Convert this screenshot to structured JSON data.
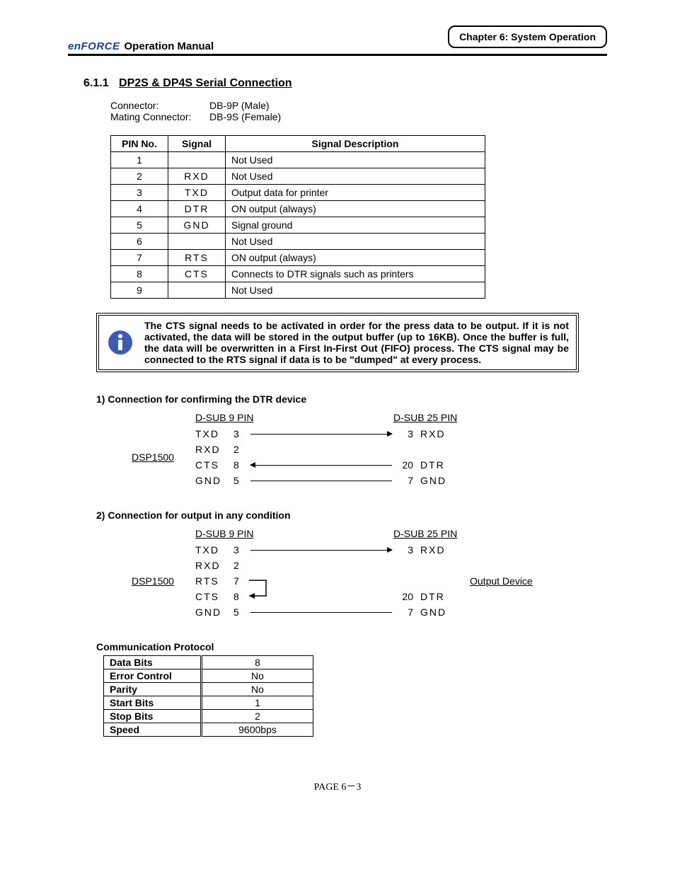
{
  "header": {
    "brand": "enFORCE",
    "manual_title": "Operation Manual",
    "chapter_box": "Chapter 6: System Operation"
  },
  "section": {
    "number": "6.1.1",
    "title": "DP2S & DP4S Serial Connection"
  },
  "connector": {
    "label1": "Connector:",
    "value1": "DB-9P (Male)",
    "label2": "Mating Connector:",
    "value2": "DB-9S (Female)"
  },
  "pin_table": {
    "headers": [
      "PIN No.",
      "Signal",
      "Signal Description"
    ],
    "rows": [
      {
        "pin": "1",
        "signal": "",
        "desc": "Not Used"
      },
      {
        "pin": "2",
        "signal": "RXD",
        "desc": "Not Used"
      },
      {
        "pin": "3",
        "signal": "TXD",
        "desc": "Output data for printer"
      },
      {
        "pin": "4",
        "signal": "DTR",
        "desc": "ON output (always)"
      },
      {
        "pin": "5",
        "signal": "GND",
        "desc": "Signal ground"
      },
      {
        "pin": "6",
        "signal": "",
        "desc": "Not Used"
      },
      {
        "pin": "7",
        "signal": "RTS",
        "desc": "ON output (always)"
      },
      {
        "pin": "8",
        "signal": "CTS",
        "desc": "Connects to DTR signals such as printers"
      },
      {
        "pin": "9",
        "signal": "",
        "desc": "Not Used"
      }
    ]
  },
  "note": "The CTS signal needs to be activated in order for the press data to be output. If it is not activated, the data will be stored in the output buffer (up to 16KB). Once the buffer is full, the data will be overwritten in a First In-First Out (FIFO) process. The CTS signal may be connected to the RTS signal if data is to be \"dumped\" at every process.",
  "diagram1": {
    "heading": "1) Connection for confirming the DTR device",
    "device": "DSP1500",
    "left_header": "D-SUB 9 PIN",
    "right_header": "D-SUB 25 PIN",
    "rows": [
      {
        "sigL": "TXD",
        "pinL": "3",
        "pinR": "3",
        "sigR": "RXD",
        "arrow": "r"
      },
      {
        "sigL": "RXD",
        "pinL": "2",
        "pinR": "",
        "sigR": "",
        "arrow": "none"
      },
      {
        "sigL": "CTS",
        "pinL": "8",
        "pinR": "20",
        "sigR": "DTR",
        "arrow": "l"
      },
      {
        "sigL": "GND",
        "pinL": "5",
        "pinR": "7",
        "sigR": "GND",
        "arrow": ""
      }
    ]
  },
  "diagram2": {
    "heading": "2) Connection for output in any condition",
    "device": "DSP1500",
    "left_header": "D-SUB 9 PIN",
    "right_header": "D-SUB 25 PIN",
    "output_device": "Output Device",
    "rows": [
      {
        "sigL": "TXD",
        "pinL": "3",
        "pinR": "3",
        "sigR": "RXD",
        "arrow": "r"
      },
      {
        "sigL": "RXD",
        "pinL": "2",
        "pinR": "",
        "sigR": "",
        "arrow": "none"
      },
      {
        "sigL": "RTS",
        "pinL": "7",
        "pinR": "",
        "sigR": "",
        "arrow": "loop_top"
      },
      {
        "sigL": "CTS",
        "pinL": "8",
        "pinR": "20",
        "sigR": "DTR",
        "arrow": "loop_bot"
      },
      {
        "sigL": "GND",
        "pinL": "5",
        "pinR": "7",
        "sigR": "GND",
        "arrow": ""
      }
    ]
  },
  "protocol": {
    "heading": "Communication Protocol",
    "rows": [
      {
        "k": "Data Bits",
        "v": "8"
      },
      {
        "k": "Error Control",
        "v": "No"
      },
      {
        "k": "Parity",
        "v": "No"
      },
      {
        "k": "Start Bits",
        "v": "1"
      },
      {
        "k": "Stop Bits",
        "v": "2"
      },
      {
        "k": "Speed",
        "v": "9600bps"
      }
    ]
  },
  "footer": "PAGE 6－3"
}
